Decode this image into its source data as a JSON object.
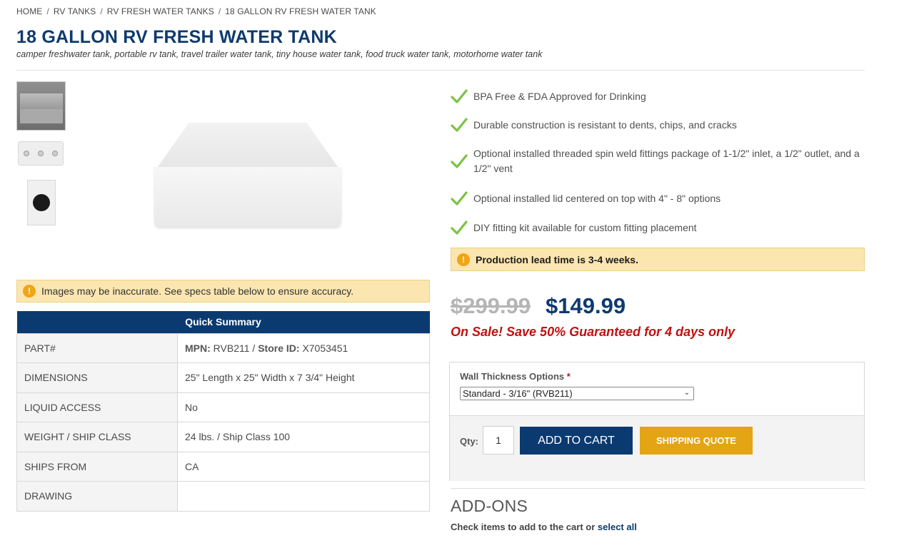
{
  "breadcrumb": [
    "HOME",
    "RV TANKS",
    "RV FRESH WATER TANKS",
    "18 GALLON RV FRESH WATER TANK"
  ],
  "product": {
    "title": "18 GALLON RV FRESH WATER TANK",
    "subtitle": "camper freshwater tank, portable rv tank, travel trailer water tank, tiny house water tank, food truck water tank, motorhome water tank"
  },
  "image_notice": "Images may be inaccurate. See specs table below to ensure accuracy.",
  "summary": {
    "header": "Quick Summary",
    "rows": [
      {
        "label": "PART#",
        "mpn_label": "MPN:",
        "mpn": "RVB211",
        "sep": " / ",
        "store_label": "Store ID:",
        "store_id": "X7053451"
      },
      {
        "label": "DIMENSIONS",
        "value": "25\" Length x 25\" Width x 7 3/4\" Height"
      },
      {
        "label": "LIQUID ACCESS",
        "value": "No"
      },
      {
        "label": "WEIGHT / SHIP CLASS",
        "value": "24 lbs. / Ship Class 100"
      },
      {
        "label": "SHIPS FROM",
        "value": "CA"
      },
      {
        "label": "DRAWING",
        "value": ""
      }
    ]
  },
  "features": [
    "BPA Free & FDA Approved for Drinking",
    "Durable construction is resistant to dents, chips, and cracks",
    "Optional installed threaded spin weld fittings package of 1-1/2\" inlet, a 1/2\" outlet, and a 1/2\" vent",
    "Optional installed lid centered on top with 4\" - 8\" options",
    "DIY fitting kit available for custom fitting placement"
  ],
  "lead_time_notice": "Production lead time is 3-4 weeks.",
  "pricing": {
    "old_price": "$299.99",
    "new_price": "$149.99",
    "sale_text": "On Sale! Save 50% Guaranteed for 4 days only"
  },
  "options": {
    "label": "Wall Thickness Options",
    "required_mark": "*",
    "selected": "Standard - 3/16\" (RVB211)"
  },
  "cart": {
    "qty_label": "Qty:",
    "qty_value": "1",
    "add_to_cart": "ADD TO CART",
    "shipping_quote": "SHIPPING QUOTE"
  },
  "addons": {
    "title": "ADD-ONS",
    "subtitle": "Check items to add to the cart or",
    "select_all": "select all"
  },
  "colors": {
    "brand_blue": "#0f3a6e",
    "accent_gold": "#e3a513",
    "sale_red": "#c21010",
    "notice_bg": "#fbe6b0",
    "check_green": "#7cc242"
  },
  "icons": {
    "warning": "exclamation-circle-icon",
    "feature": "checkmark-icon",
    "select": "chevron-down-icon"
  }
}
